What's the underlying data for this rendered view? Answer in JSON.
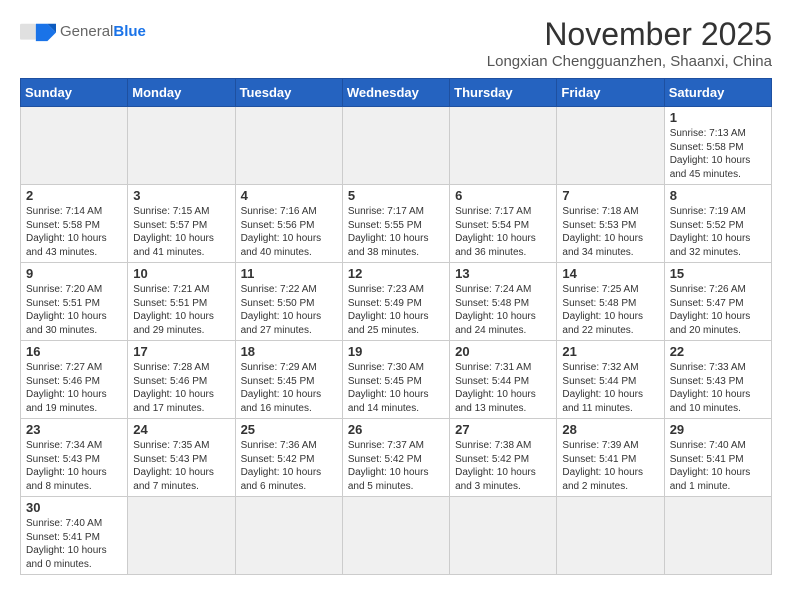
{
  "logo": {
    "general": "General",
    "blue": "Blue"
  },
  "title": "November 2025",
  "location": "Longxian Chengguanzhen, Shaanxi, China",
  "headers": [
    "Sunday",
    "Monday",
    "Tuesday",
    "Wednesday",
    "Thursday",
    "Friday",
    "Saturday"
  ],
  "weeks": [
    [
      {
        "day": "",
        "info": "",
        "empty": true
      },
      {
        "day": "",
        "info": "",
        "empty": true
      },
      {
        "day": "",
        "info": "",
        "empty": true
      },
      {
        "day": "",
        "info": "",
        "empty": true
      },
      {
        "day": "",
        "info": "",
        "empty": true
      },
      {
        "day": "",
        "info": "",
        "empty": true
      },
      {
        "day": "1",
        "info": "Sunrise: 7:13 AM\nSunset: 5:58 PM\nDaylight: 10 hours and 45 minutes."
      }
    ],
    [
      {
        "day": "2",
        "info": "Sunrise: 7:14 AM\nSunset: 5:58 PM\nDaylight: 10 hours and 43 minutes."
      },
      {
        "day": "3",
        "info": "Sunrise: 7:15 AM\nSunset: 5:57 PM\nDaylight: 10 hours and 41 minutes."
      },
      {
        "day": "4",
        "info": "Sunrise: 7:16 AM\nSunset: 5:56 PM\nDaylight: 10 hours and 40 minutes."
      },
      {
        "day": "5",
        "info": "Sunrise: 7:17 AM\nSunset: 5:55 PM\nDaylight: 10 hours and 38 minutes."
      },
      {
        "day": "6",
        "info": "Sunrise: 7:17 AM\nSunset: 5:54 PM\nDaylight: 10 hours and 36 minutes."
      },
      {
        "day": "7",
        "info": "Sunrise: 7:18 AM\nSunset: 5:53 PM\nDaylight: 10 hours and 34 minutes."
      },
      {
        "day": "8",
        "info": "Sunrise: 7:19 AM\nSunset: 5:52 PM\nDaylight: 10 hours and 32 minutes."
      }
    ],
    [
      {
        "day": "9",
        "info": "Sunrise: 7:20 AM\nSunset: 5:51 PM\nDaylight: 10 hours and 30 minutes."
      },
      {
        "day": "10",
        "info": "Sunrise: 7:21 AM\nSunset: 5:51 PM\nDaylight: 10 hours and 29 minutes."
      },
      {
        "day": "11",
        "info": "Sunrise: 7:22 AM\nSunset: 5:50 PM\nDaylight: 10 hours and 27 minutes."
      },
      {
        "day": "12",
        "info": "Sunrise: 7:23 AM\nSunset: 5:49 PM\nDaylight: 10 hours and 25 minutes."
      },
      {
        "day": "13",
        "info": "Sunrise: 7:24 AM\nSunset: 5:48 PM\nDaylight: 10 hours and 24 minutes."
      },
      {
        "day": "14",
        "info": "Sunrise: 7:25 AM\nSunset: 5:48 PM\nDaylight: 10 hours and 22 minutes."
      },
      {
        "day": "15",
        "info": "Sunrise: 7:26 AM\nSunset: 5:47 PM\nDaylight: 10 hours and 20 minutes."
      }
    ],
    [
      {
        "day": "16",
        "info": "Sunrise: 7:27 AM\nSunset: 5:46 PM\nDaylight: 10 hours and 19 minutes."
      },
      {
        "day": "17",
        "info": "Sunrise: 7:28 AM\nSunset: 5:46 PM\nDaylight: 10 hours and 17 minutes."
      },
      {
        "day": "18",
        "info": "Sunrise: 7:29 AM\nSunset: 5:45 PM\nDaylight: 10 hours and 16 minutes."
      },
      {
        "day": "19",
        "info": "Sunrise: 7:30 AM\nSunset: 5:45 PM\nDaylight: 10 hours and 14 minutes."
      },
      {
        "day": "20",
        "info": "Sunrise: 7:31 AM\nSunset: 5:44 PM\nDaylight: 10 hours and 13 minutes."
      },
      {
        "day": "21",
        "info": "Sunrise: 7:32 AM\nSunset: 5:44 PM\nDaylight: 10 hours and 11 minutes."
      },
      {
        "day": "22",
        "info": "Sunrise: 7:33 AM\nSunset: 5:43 PM\nDaylight: 10 hours and 10 minutes."
      }
    ],
    [
      {
        "day": "23",
        "info": "Sunrise: 7:34 AM\nSunset: 5:43 PM\nDaylight: 10 hours and 8 minutes."
      },
      {
        "day": "24",
        "info": "Sunrise: 7:35 AM\nSunset: 5:43 PM\nDaylight: 10 hours and 7 minutes."
      },
      {
        "day": "25",
        "info": "Sunrise: 7:36 AM\nSunset: 5:42 PM\nDaylight: 10 hours and 6 minutes."
      },
      {
        "day": "26",
        "info": "Sunrise: 7:37 AM\nSunset: 5:42 PM\nDaylight: 10 hours and 5 minutes."
      },
      {
        "day": "27",
        "info": "Sunrise: 7:38 AM\nSunset: 5:42 PM\nDaylight: 10 hours and 3 minutes."
      },
      {
        "day": "28",
        "info": "Sunrise: 7:39 AM\nSunset: 5:41 PM\nDaylight: 10 hours and 2 minutes."
      },
      {
        "day": "29",
        "info": "Sunrise: 7:40 AM\nSunset: 5:41 PM\nDaylight: 10 hours and 1 minute."
      }
    ],
    [
      {
        "day": "30",
        "info": "Sunrise: 7:40 AM\nSunset: 5:41 PM\nDaylight: 10 hours and 0 minutes."
      },
      {
        "day": "",
        "info": "",
        "empty": true
      },
      {
        "day": "",
        "info": "",
        "empty": true
      },
      {
        "day": "",
        "info": "",
        "empty": true
      },
      {
        "day": "",
        "info": "",
        "empty": true
      },
      {
        "day": "",
        "info": "",
        "empty": true
      },
      {
        "day": "",
        "info": "",
        "empty": true
      }
    ]
  ]
}
